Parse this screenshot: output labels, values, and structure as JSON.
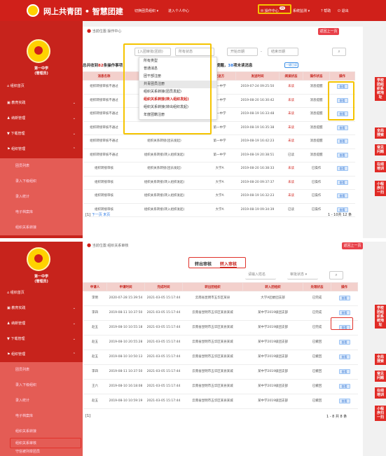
{
  "header": {
    "brand": "网上共青团 • 智慧团建",
    "nav_switch": "切换团员组织",
    "nav_personal": "进入个人中心",
    "ops_center": "操作中心",
    "ops_badge": "99",
    "supervision": "系统监测",
    "help": "帮助",
    "logout": "退出"
  },
  "sidebar": {
    "org_name": "第一中学",
    "org_role": "(管理员)",
    "items": [
      {
        "label": "组织首页"
      },
      {
        "label": "教育实践"
      },
      {
        "label": "纳新管理"
      },
      {
        "label": "下载管理"
      },
      {
        "label": "组织管理"
      }
    ],
    "sub_items_1": [
      "团员列表",
      "录入下级组织",
      "录入统计",
      "电子档案库",
      "组织关系转接"
    ],
    "sub_items_2": [
      "团员列表",
      "录入下级组织",
      "录入统计",
      "电子档案库",
      "组织关系转接",
      "组织关系审核",
      "守信被列举团员",
      "档案复核"
    ]
  },
  "page1": {
    "breadcrumb": "当前位置:操作中心",
    "back": "返回上一页",
    "filter_type": "[入团审批(团前)",
    "filter_status": "所有状态",
    "date_start": "开始日期",
    "date_sep": "-",
    "date_end": "结束日期",
    "search_icon": "search-icon",
    "summary_prefix": "总共收到",
    "summary_total": "82",
    "summary_mid": "条操作事项，",
    "summary_unread_count": "7",
    "summary_unread_label": "条消息提醒，",
    "summary_unhandled_count": "38",
    "summary_unhandled_label": "项未读消息",
    "mark_read": "一键已读",
    "columns": [
      "消息名称",
      "事项内容",
      "发送方",
      "发送时间",
      "阅读状态",
      "操作状态",
      "操作"
    ],
    "rows": [
      [
        "组织转接审核不通过",
        "",
        "第一中学",
        "2019-07-24 09:25:50",
        "未读",
        "消息提醒",
        "查看"
      ],
      [
        "组织转接审核不通过",
        "",
        "第一中学",
        "2019-08-20 16:30:42",
        "未读",
        "消息提醒",
        "查看"
      ],
      [
        "组织转接审核不通过",
        "",
        "第一中学",
        "2019-08-19 16:33:48",
        "未读",
        "消息提醒",
        "查看"
      ],
      [
        "组织转接审核不通过",
        "",
        "第一中学",
        "2019-08-19 16:35:38",
        "未读",
        "消息提醒",
        "查看"
      ],
      [
        "组织转接审核不通过",
        "组织关系转接(团员发起)",
        "第一中学",
        "2019-08-19 16:42:23",
        "未读",
        "消息提醒",
        "查看"
      ],
      [
        "组织转接审核不通过",
        "组织关系转接(转入组织发起)",
        "第一中学",
        "2019-08-19 20:38:51",
        "已读",
        "消息提醒",
        "查看"
      ],
      [
        "组织转接审核",
        "组织关系转接(团员发起)",
        "大学A",
        "2019-08-20 16:38:33",
        "未读",
        "已操作",
        "查看"
      ],
      [
        "组织转接审核",
        "组织关系转接(转入组织发起)",
        "大学A",
        "2019-08-20 09:37:37",
        "未读",
        "已操作",
        "查看"
      ],
      [
        "组织转接审核",
        "组织关系转接(转入组织发起)",
        "大学A",
        "2019-08-19 16:32:23",
        "未读",
        "已操作",
        "查看"
      ],
      [
        "组织转接审核",
        "组织关系转接(转入组织发起)",
        "大学A",
        "2019-08-19 09:34:39",
        "已读",
        "已操作",
        "查看"
      ]
    ],
    "pager_prev": "[1]",
    "pager_next": "下一页 末页",
    "pager_info": "1 - 10共 12 条",
    "dropdown": [
      "所有类型",
      "普通消息",
      "团干部注册",
      "共青团员注册",
      "组织关系转接(团员发起)",
      "组织关系转接(转入组织发起)",
      "组织关系转接(转出组织发起)",
      "年度团籍注册"
    ]
  },
  "page2": {
    "breadcrumb": "当前位置:组织关系审核",
    "back": "返回上一页",
    "tab_out": "转出审核",
    "tab_in": "转入审核",
    "filter_name": "请输入姓名",
    "filter_status": "审批状态",
    "columns": [
      "申请人",
      "申请时间",
      "完成时间",
      "转出团组织",
      "转入团组织",
      "处理状态",
      "操作"
    ],
    "rows": [
      [
        "李明",
        "2020-07-28 15:39:54",
        "2021-03-05 15:17:44",
        "云南省昆明市五华区某县",
        "大学A团委团支部",
        "已完成",
        "查看"
      ],
      [
        "李四",
        "2019-08-11 10:37:50",
        "2021-03-05 15:17:44",
        "云南省昆明市五华区某县某城",
        "某中学2019级团支部",
        "已完成",
        "查看"
      ],
      [
        "赵五",
        "2019-08-10 10:55:18",
        "2021-03-05 15:17:44",
        "云南省昆明市五华区某县某城",
        "某中学2019级团支部",
        "已完成",
        "查看"
      ],
      [
        "赵五",
        "2019-08-10 20:55:28",
        "2021-03-05 15:17:44",
        "云南省昆明市五华区某县某城",
        "某中学2019级团支部",
        "已撤回",
        "查看"
      ],
      [
        "赵五",
        "2019-08-10 10:50:13",
        "2021-03-05 15:17:44",
        "云南省昆明市五华区某县某城",
        "某中学2019级团支部",
        "已撤回",
        "查看"
      ],
      [
        "李四",
        "2019-08-11 10:37:50",
        "2021-03-05 15:17:44",
        "云南省昆明市五华区某县某城",
        "某中学2019级团支部",
        "已撤回",
        "查看"
      ],
      [
        "王六",
        "2019-08-10 16:18:08",
        "2021-03-05 15:17:44",
        "云南省昆明市五华区某县某城",
        "某中学2019级团支部",
        "已撤回",
        "查看"
      ],
      [
        "赵五",
        "2019-08-10 10:59:19",
        "2021-03-05 15:17:44",
        "云南省昆明市五华区某县某城",
        "某中学2019级团支部",
        "已撤回",
        "查看"
      ]
    ],
    "to_org": "云南省昆明市五华区某县某城 第一中学团委",
    "pager_prev": "[1]",
    "pager_info": "1 - 8 共 8 条"
  },
  "float_tabs": [
    "学校团组织系统地址",
    "全局搜索",
    "常见问题",
    "在线培训",
    "小程序扫一扫"
  ]
}
